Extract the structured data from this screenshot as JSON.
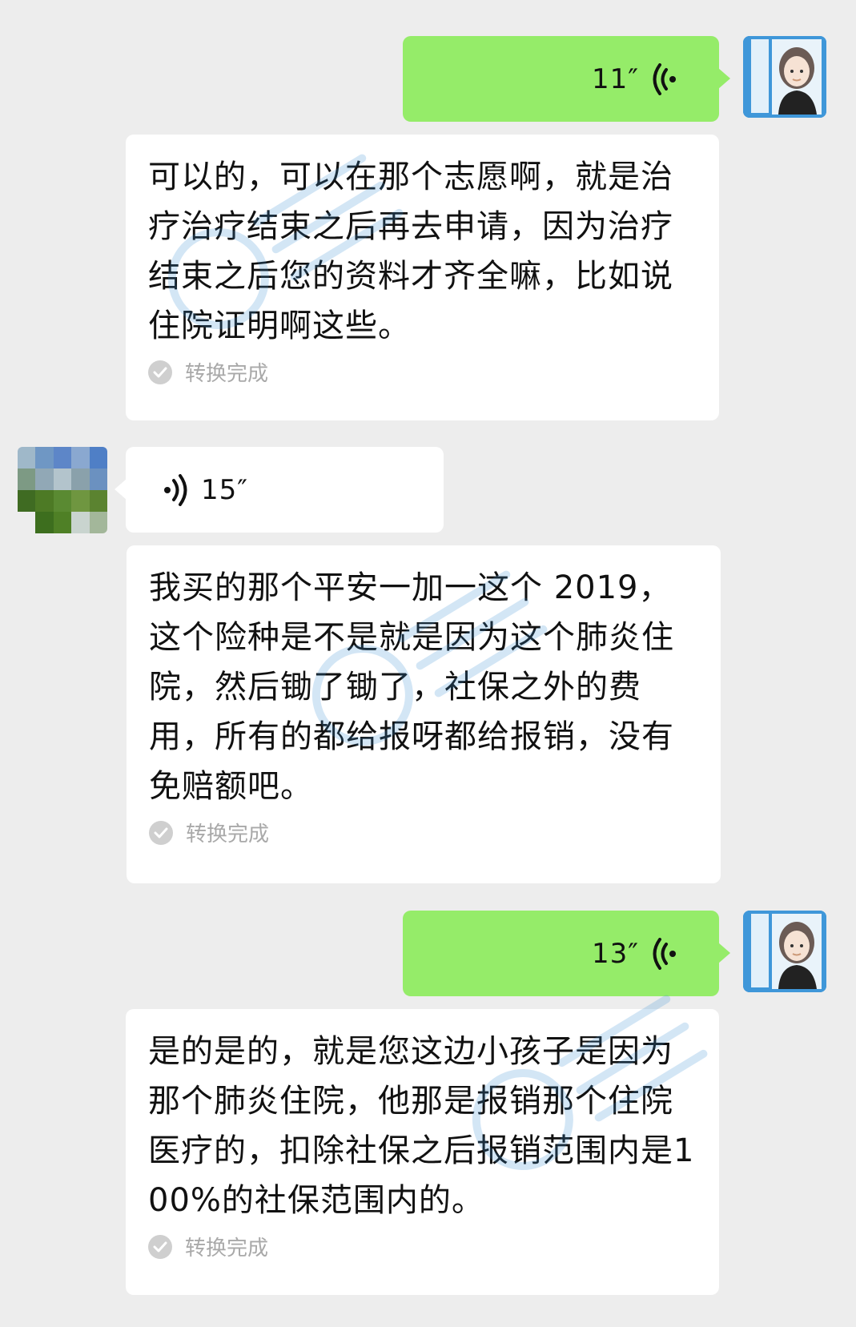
{
  "messages": [
    {
      "voice_duration": "11″",
      "transcript": "可以的，可以在那个志愿啊，就是治疗治疗结束之后再去申请，因为治疗结束之后您的资料才齐全嘛，比如说住院证明啊这些。",
      "status": "转换完成"
    },
    {
      "voice_duration": "15″"
    },
    {
      "transcript": "我买的那个平安一加一这个 2019，这个险种是不是就是因为这个肺炎住院，然后锄了锄了，社保之外的费用，所有的都给报呀都给报销，没有免赔额吧。",
      "status": "转换完成"
    },
    {
      "voice_duration": "13″",
      "transcript": "是的是的，就是您这边小孩子是因为那个肺炎住院，他那是报销那个住院医疗的，扣除社保之后报销范围内是100%的社保范围内的。",
      "status": "转换完成"
    }
  ],
  "colors": {
    "background": "#ededed",
    "outgoing_bubble": "#95ec69",
    "incoming_bubble": "#ffffff",
    "status_text": "#a9a9a9",
    "watermark": "#3a8fd6"
  },
  "icons": {
    "voice_out": "voice-wave-left-icon",
    "voice_in": "voice-wave-right-icon",
    "status": "check-circle-icon"
  }
}
